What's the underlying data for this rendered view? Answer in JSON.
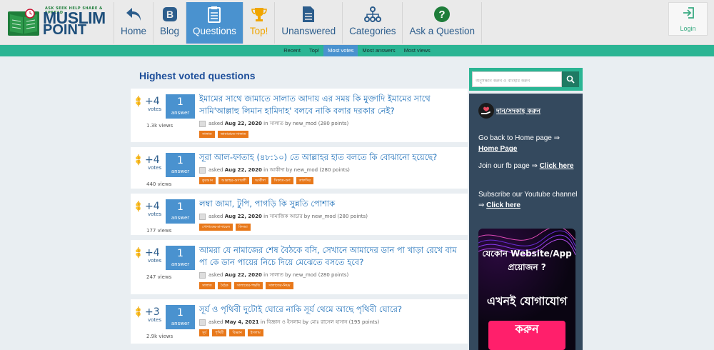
{
  "logo": {
    "tagline": "ASK  SEEK  HELP  SHARE & SPREAD",
    "line1": "MUSLIM",
    "line2": "POINT"
  },
  "nav": [
    {
      "label": "Home",
      "icon": "back-arrow-icon"
    },
    {
      "label": "Blog",
      "icon": "blog-icon"
    },
    {
      "label": "Questions",
      "icon": "clipboard-icon"
    },
    {
      "label": "Top!",
      "icon": "trophy-icon"
    },
    {
      "label": "Unanswered",
      "icon": "document-icon"
    },
    {
      "label": "Categories",
      "icon": "sitemap-icon"
    },
    {
      "label": "Ask a Question",
      "icon": "question-circle-icon"
    }
  ],
  "login": "Login",
  "subnav": [
    "Recent",
    "Top!",
    "Most votes",
    "Most answers",
    "Most views"
  ],
  "page_title": "Highest voted questions",
  "questions": [
    {
      "votes": "+4",
      "votes_label": "votes",
      "answers": "1",
      "answers_label": "answer",
      "views": "1.3k views",
      "title": "ইমামের সাথে জামাতে সালাত আদায় এর সময় কি মুক্তাদি ইমামের সাথে সামি'আল্লাহু লিমান হামিদাহ' বলবে নাকি বলার দরকার নেই?",
      "asked": "asked",
      "date": "Aug 22, 2020",
      "in": "in",
      "category": "সালাত",
      "by": "by",
      "user": "new_mod",
      "points": "(280 points)",
      "tags": [
        "সালাত",
        "জামায়াতে-সালাত"
      ]
    },
    {
      "votes": "+4",
      "votes_label": "votes",
      "answers": "1",
      "answers_label": "answer",
      "views": "440 views",
      "title": "সূরা আল-ফাতাহ (৪৮:১০) তে আল্লাহর হাত বলতে কি বোঝানো হয়েছে?",
      "asked": "asked",
      "date": "Aug 22, 2020",
      "in": "in",
      "category": "আকীদা",
      "by": "by",
      "user": "new_mod",
      "points": "(280 points)",
      "tags": [
        "কুরআন",
        "আল্লাহর-গুণাবলী",
        "আকীদা",
        "সিফাত-গুণ",
        "তাফসির"
      ]
    },
    {
      "votes": "+4",
      "votes_label": "votes",
      "answers": "1",
      "answers_label": "answer",
      "views": "177 views",
      "title": "লম্বা জামা, টুপি, পাগড়ি কি সুন্নতি পোশাক",
      "asked": "asked",
      "date": "Aug 22, 2020",
      "in": "in",
      "category": "সামাজিক আচার",
      "by": "by",
      "user": "new_mod",
      "points": "(280 points)",
      "tags": [
        "পোশাকের-মাসায়েল",
        "বিদআ"
      ]
    },
    {
      "votes": "+4",
      "votes_label": "votes",
      "answers": "1",
      "answers_label": "answer",
      "views": "247 views",
      "title": "আমরা যে নামাজের শেষ বৈঠকে বসি, সেখানে আমাদের ডান পা খাড়া রেখে বাম পা কে ডান পায়ের নিচে দিয়ে মেঝেতে বসতে হবে?",
      "asked": "asked",
      "date": "Aug 22, 2020",
      "in": "in",
      "category": "সালাত",
      "by": "by",
      "user": "new_mod",
      "points": "(280 points)",
      "tags": [
        "সালাত",
        "বৈঠক",
        "সালাতের-পদ্ধতি",
        "সালাতের-নিয়ম"
      ]
    },
    {
      "votes": "+3",
      "votes_label": "votes",
      "answers": "1",
      "answers_label": "answer",
      "views": "2.9k views",
      "title": "সূর্য ও পৃথিবী দুটোই ঘোরে নাকি সূর্য থেমে আছে পৃথিবী ঘোরে?",
      "asked": "asked",
      "date": "May 4, 2021",
      "in": "in",
      "category": "বিজ্ঞান ও ইসলাম",
      "by": "by",
      "user": "মোঃ রাসেল হাসান",
      "points": "(195 points)",
      "tags": [
        "সূর্য",
        "পৃথিবী",
        "বিজ্ঞান",
        "ইসলাম"
      ]
    }
  ],
  "search": {
    "placeholder": "অনুসন্ধান করুন ও ব্যবহার করুন"
  },
  "sidebar": {
    "donate": "দান/সদকাহ করুন",
    "home_text": "Go back to Home page ⇒",
    "home_link": "Home Page",
    "fb_text": "Join our fb page ⇒",
    "fb_link": "Click here",
    "yt_text": "Subscribe our Youtube channel ⇒",
    "yt_link": "Click here"
  },
  "ad": {
    "line1": "যেকোন Website/App প্রয়োজন ?",
    "line2": "এখনই যোগাযোগ",
    "line3": "করুন"
  },
  "colors": {
    "accent": "#4a92cf",
    "brand_green": "#2bb594",
    "tag": "#e8781a",
    "sidebar": "#34495e"
  }
}
